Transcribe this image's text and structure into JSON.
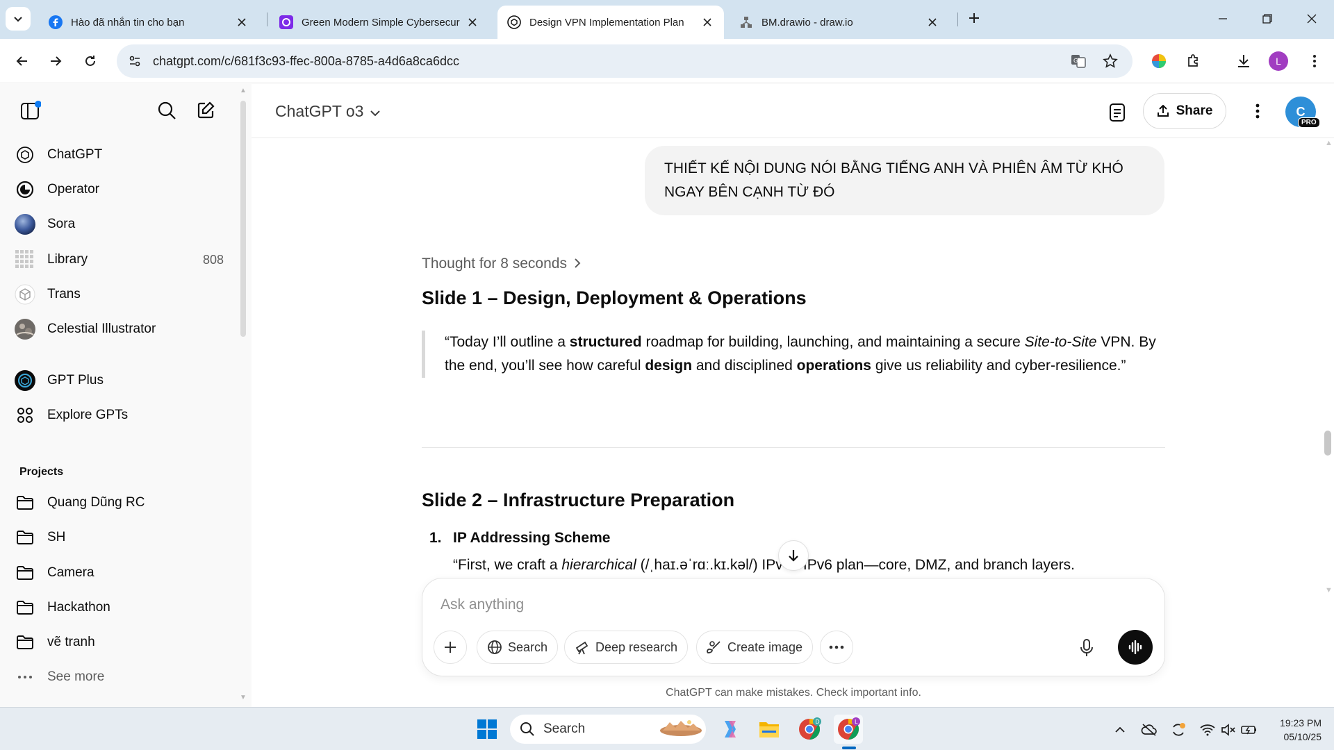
{
  "browser": {
    "tabs": [
      {
        "title": "Hào đã nhắn tin cho bạn",
        "icon": "facebook-icon"
      },
      {
        "title": "Green Modern Simple Cybersecuri",
        "icon": "canva-icon"
      },
      {
        "title": "Design VPN Implementation Plan",
        "icon": "chatgpt-icon",
        "active": true
      },
      {
        "title": "BM.drawio - draw.io",
        "icon": "drawio-icon"
      }
    ],
    "url": "chatgpt.com/c/681f3c93-ffec-800a-8785-a4d6a8ca6dcc",
    "profile_initial": "L"
  },
  "sidebar": {
    "items": [
      {
        "label": "ChatGPT",
        "icon": "openai-logo-icon"
      },
      {
        "label": "Operator",
        "icon": "operator-icon"
      },
      {
        "label": "Sora",
        "icon": "sora-icon"
      },
      {
        "label": "Library",
        "icon": "library-icon",
        "count": "808"
      },
      {
        "label": "Trans",
        "icon": "cube-icon"
      },
      {
        "label": "Celestial Illustrator",
        "icon": "celestial-avatar-icon"
      },
      {
        "label": "GPT Plus",
        "icon": "gpt-plus-icon"
      },
      {
        "label": "Explore GPTs",
        "icon": "grid-icon"
      }
    ],
    "projects_heading": "Projects",
    "projects": [
      {
        "label": "Quang Dũng RC"
      },
      {
        "label": "SH"
      },
      {
        "label": "Camera"
      },
      {
        "label": "Hackathon"
      },
      {
        "label": "vẽ tranh"
      }
    ],
    "see_more": "See more"
  },
  "header": {
    "model": "ChatGPT o3",
    "share_label": "Share",
    "avatar_initial": "C",
    "pro_badge": "PRO"
  },
  "chat": {
    "user_message_line1": "THIẾT KẾ NỘI DUNG NÓI BẰNG TIẾNG ANH VÀ PHIÊN ÂM TỪ KHÓ",
    "user_message_line2": "NGAY BÊN CẠNH TỪ ĐÓ",
    "thought": "Thought for 8 seconds",
    "slide1_title": "Slide 1 – Design, Deployment & Operations",
    "slide1_quote": {
      "p1": "“Today I’ll outline a ",
      "b1": "structured",
      "p2": " roadmap for building, launching, and maintaining a secure ",
      "i1": "Site-to-Site",
      "p3": " VPN. By the end, you’ll see how careful ",
      "b2": "design",
      "p4": " and disciplined ",
      "b3": "operations",
      "p5": " give us reliability and cyber-resilience.”"
    },
    "slide2_title": "Slide 2 – Infrastructure Preparation",
    "slide2_item_number": "1.",
    "slide2_item_title": "IP Addressing Scheme",
    "slide2_item_body": {
      "p1": "“First, we craft a ",
      "i1": "hierarchical",
      "p2": " (/ˌhaɪ.əˈrɑː.kɪ.kəl/) IPv4 / IPv6 plan—core, DMZ, and branch layers."
    }
  },
  "composer": {
    "placeholder": "Ask anything",
    "buttons": [
      "Search",
      "Deep research",
      "Create image"
    ],
    "disclaimer": "ChatGPT can make mistakes. Check important info."
  },
  "taskbar": {
    "search_label": "Search",
    "time": "19:23 PM",
    "date": "05/10/25"
  }
}
